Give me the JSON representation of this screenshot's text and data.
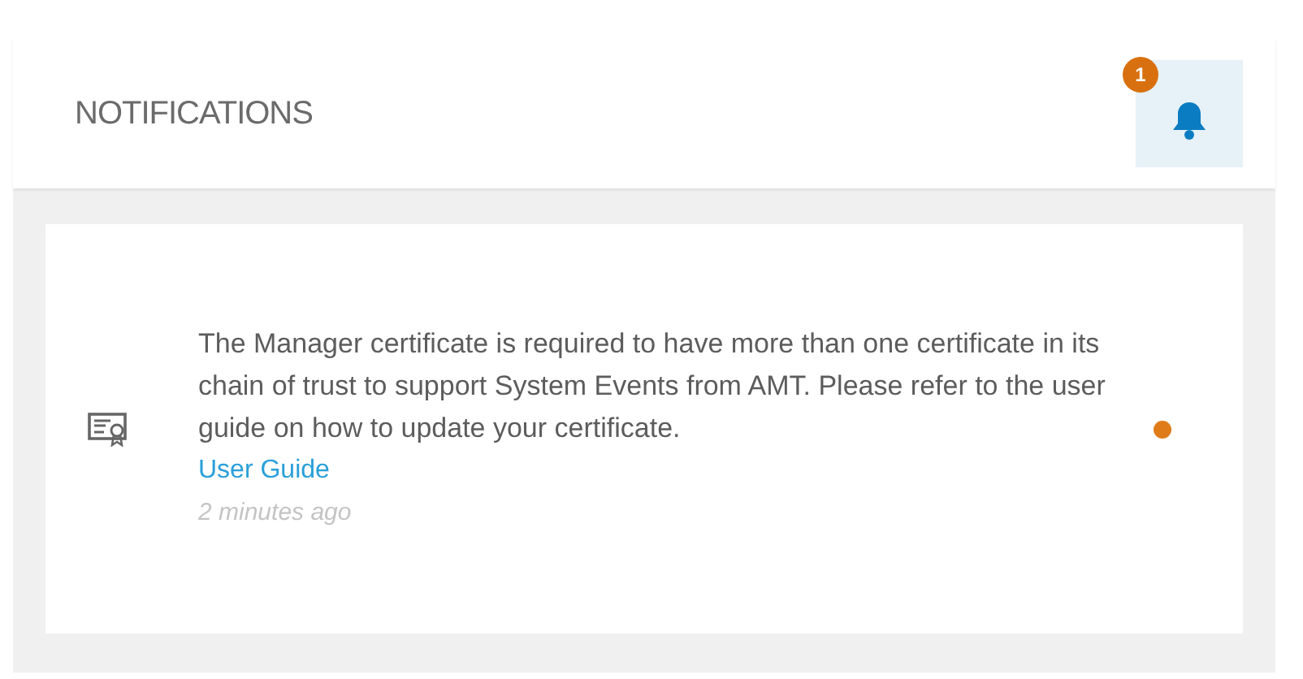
{
  "header": {
    "title": "NOTIFICATIONS",
    "badge": "1"
  },
  "notifications": [
    {
      "message": "The Manager certificate is required to have more than one certificate in its chain of trust to support System Events from AMT. Please refer to the user guide on how to update your certificate.",
      "link": "User Guide",
      "time": "2 minutes ago",
      "unread": true
    }
  ]
}
